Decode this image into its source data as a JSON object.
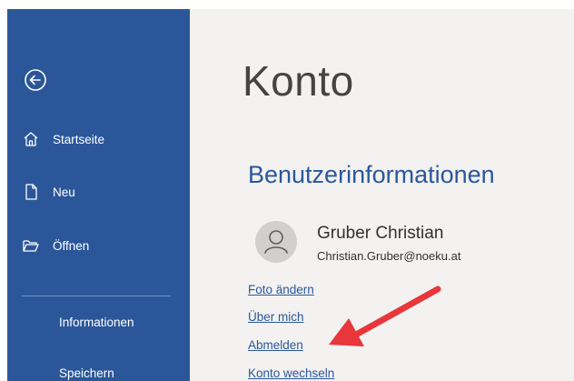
{
  "sidebar": {
    "back_icon": "back-arrow-circle-icon",
    "items": [
      {
        "label": "Startseite",
        "icon": "home-icon"
      },
      {
        "label": "Neu",
        "icon": "new-document-icon"
      },
      {
        "label": "Öffnen",
        "icon": "open-folder-icon"
      }
    ],
    "text_items": [
      {
        "label": "Informationen"
      },
      {
        "label": "Speichern"
      }
    ]
  },
  "main": {
    "title": "Konto",
    "section_title": "Benutzerinformationen",
    "user": {
      "name": "Gruber Christian",
      "email": "Christian.Gruber@noeku.at",
      "avatar_icon": "person-icon"
    },
    "links": [
      {
        "label": "Foto ändern"
      },
      {
        "label": "Über mich"
      },
      {
        "label": "Abmelden"
      },
      {
        "label": "Konto wechseln"
      }
    ]
  },
  "colors": {
    "sidebar_bg": "#2b579a",
    "main_bg": "#f3f2f1",
    "link": "#2b579a",
    "annotation_arrow": "#e8363b"
  }
}
